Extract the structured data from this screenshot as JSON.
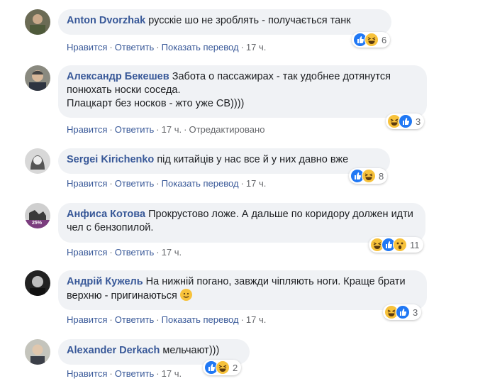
{
  "comments": [
    {
      "author": "Anton Dvorzhak",
      "text": "русскіе шо не зроблять - получається танк",
      "actions": {
        "like": "Нравится",
        "reply": "Ответить",
        "translate": "Показать перевод",
        "time": "17 ч."
      },
      "reactions": [
        "like",
        "haha"
      ],
      "reaction_count": "6"
    },
    {
      "author": "Александр Бекешев",
      "text": "Забота о пассажирах - так удобнее дотянутся понюхать носки соседа.",
      "text2": "Плацкарт без носков - жто уже СВ))))",
      "actions": {
        "like": "Нравится",
        "reply": "Ответить",
        "time": "17 ч.",
        "edited": "Отредактировано"
      },
      "reactions": [
        "haha",
        "like"
      ],
      "reaction_count": "3"
    },
    {
      "author": "Sergei Kirichenko",
      "text": "під китайців у нас все й у них давно вже",
      "actions": {
        "like": "Нравится",
        "reply": "Ответить",
        "translate": "Показать перевод",
        "time": "17 ч."
      },
      "reactions": [
        "like",
        "haha"
      ],
      "reaction_count": "8"
    },
    {
      "author": "Анфиса Котова",
      "text": "Прокрустово ложе. А дальше по коридору должен идти чел с бензопилой.",
      "actions": {
        "like": "Нравится",
        "reply": "Ответить",
        "time": "17 ч."
      },
      "reactions": [
        "haha",
        "like",
        "wow"
      ],
      "reaction_count": "11",
      "avatar_badge": "25%"
    },
    {
      "author": "Андрій Кужель",
      "text": "На нижній погано, завжди чіпляють ноги. Краще брати верхню - пригинаються",
      "actions": {
        "like": "Нравится",
        "reply": "Ответить",
        "translate": "Показать перевод",
        "time": "17 ч."
      },
      "reactions": [
        "haha",
        "like"
      ],
      "reaction_count": "3"
    },
    {
      "author": "Alexander Derkach",
      "text": "мельчают)))",
      "actions": {
        "like": "Нравится",
        "reply": "Ответить",
        "time": "17 ч."
      },
      "reactions": [
        "like",
        "haha"
      ],
      "reaction_count": "2"
    }
  ],
  "colors": {
    "author": "#385898",
    "bubble": "#f0f2f5",
    "muted": "#65676b",
    "like": "#2078f4",
    "haha": "#f7c23b"
  }
}
